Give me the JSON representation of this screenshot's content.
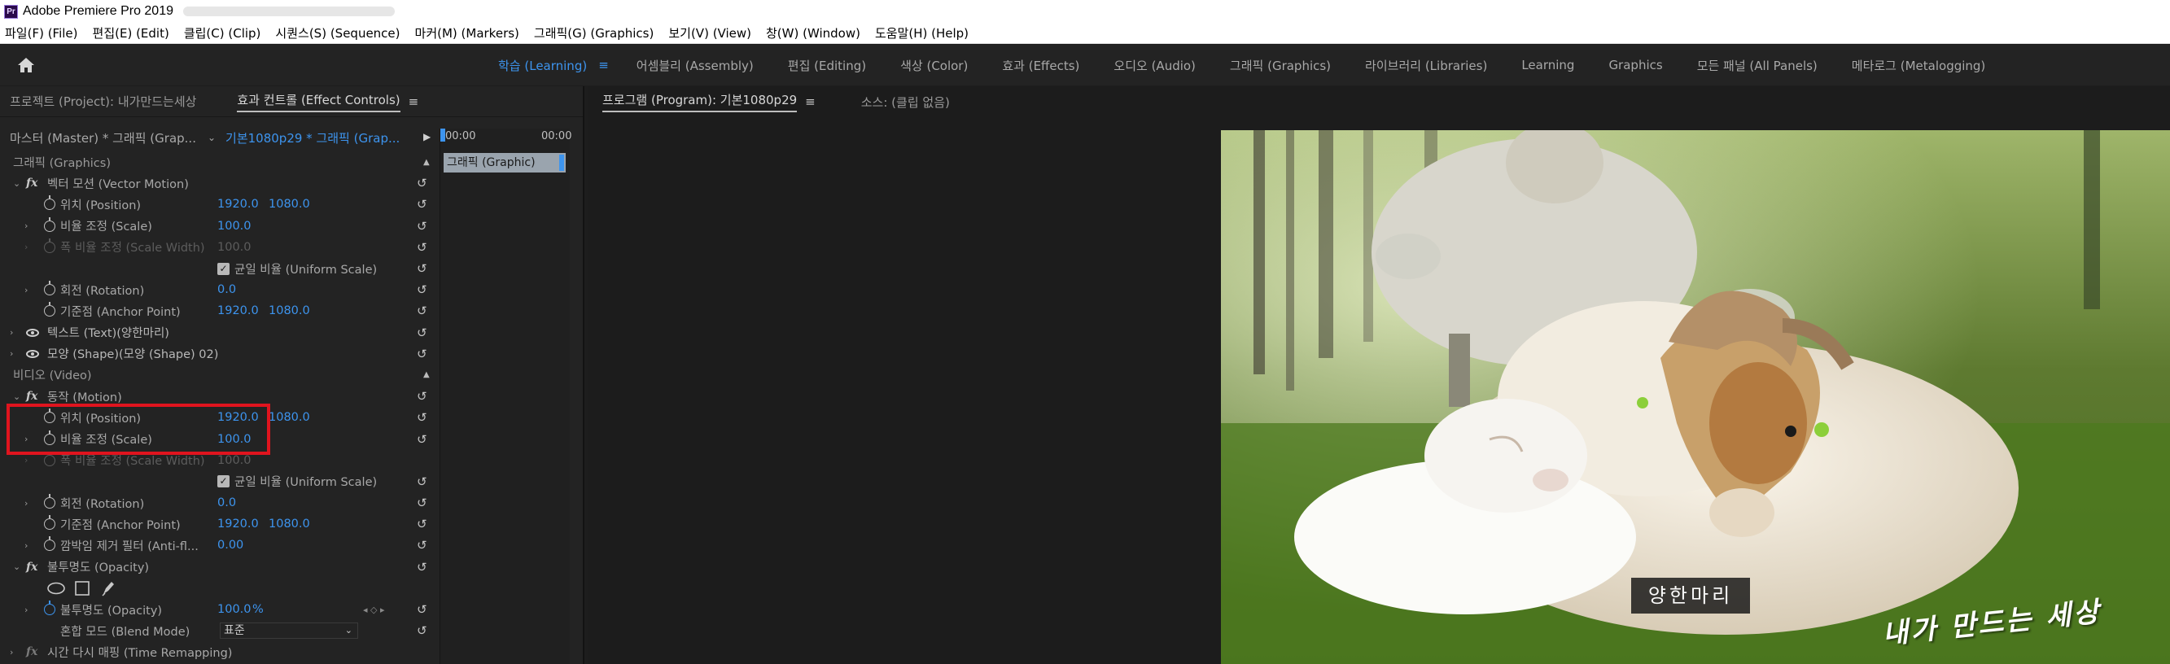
{
  "window": {
    "title": "Adobe Premiere Pro 2019",
    "logo_text": "Pr"
  },
  "menu": {
    "items": [
      "파일(F) (File)",
      "편집(E) (Edit)",
      "클립(C) (Clip)",
      "시퀀스(S) (Sequence)",
      "마커(M) (Markers)",
      "그래픽(G) (Graphics)",
      "보기(V) (View)",
      "창(W) (Window)",
      "도움말(H) (Help)"
    ]
  },
  "workspaces": {
    "active": "학습 (Learning)",
    "menu_glyph": "≡",
    "items": [
      "어셈블리 (Assembly)",
      "편집 (Editing)",
      "색상 (Color)",
      "효과 (Effects)",
      "오디오 (Audio)",
      "그래픽 (Graphics)",
      "라이브러리 (Libraries)",
      "Learning",
      "Graphics",
      "모든 패널 (All Panels)",
      "메타로그 (Metalogging)"
    ]
  },
  "left_panel": {
    "tab_project": "프로젝트 (Project): 내가만드는세상",
    "tab_effect_controls": "효과 컨트롤 (Effect Controls)",
    "tab_menu": "≡",
    "master_label": "마스터 (Master) * 그래픽 (Grap...",
    "clip_label": "기본1080p29 * 그래픽 (Grap...",
    "timeline_start": "00:00",
    "timeline_end": "00:00",
    "timeline_clip": "그래픽 (Graphic)",
    "rows": {
      "graphics_section": "그래픽 (Graphics)",
      "vector_motion": "벡터 모션 (Vector Motion)",
      "position1": "위치 (Position)",
      "position1_x": "1920.0",
      "position1_y": "1080.0",
      "scale1": "비율 조정 (Scale)",
      "scale1_v": "100.0",
      "scale_width1": "폭 비율 조정 (Scale Width)",
      "scale_width1_v": "100.0",
      "uniform1": "균일 비율 (Uniform Scale)",
      "rotation1": "회전 (Rotation)",
      "rotation1_v": "0.0",
      "anchor1": "기준점 (Anchor Point)",
      "anchor1_x": "1920.0",
      "anchor1_y": "1080.0",
      "text_layer": "텍스트 (Text)(양한마리)",
      "shape_layer": "모양 (Shape)(모양 (Shape) 02)",
      "video_section": "비디오 (Video)",
      "motion": "동작 (Motion)",
      "position2": "위치 (Position)",
      "position2_x": "1920.0",
      "position2_y": "1080.0",
      "scale2": "비율 조정 (Scale)",
      "scale2_v": "100.0",
      "scale_width2": "폭 비율 조정 (Scale Width)",
      "scale_width2_v": "100.0",
      "uniform2": "균일 비율 (Uniform Scale)",
      "rotation2": "회전 (Rotation)",
      "rotation2_v": "0.0",
      "anchor2": "기준점 (Anchor Point)",
      "anchor2_x": "1920.0",
      "anchor2_y": "1080.0",
      "antiflicker": "깜박임 제거 필터 (Anti-fl...",
      "antiflicker_v": "0.00",
      "opacity_section": "불투명도 (Opacity)",
      "opacity": "불투명도 (Opacity)",
      "opacity_v": "100.0",
      "opacity_unit": "%",
      "blend_mode": "혼합 모드 (Blend Mode)",
      "blend_mode_v": "표준",
      "time_remap": "시간 다시 매핑 (Time Remapping)"
    },
    "reset_glyph": "↺",
    "check_glyph": "✓"
  },
  "right_panel": {
    "tab_program": "프로그램 (Program): 기본1080p29",
    "tab_menu": "≡",
    "tab_source": "소스: (클립 없음)",
    "subtitle": "양한마리",
    "watermark": "내가 만드는 세상"
  },
  "colors": {
    "accent_blue": "#3d94ee",
    "highlight_red": "#e0141e",
    "panel_bg": "#232323"
  }
}
